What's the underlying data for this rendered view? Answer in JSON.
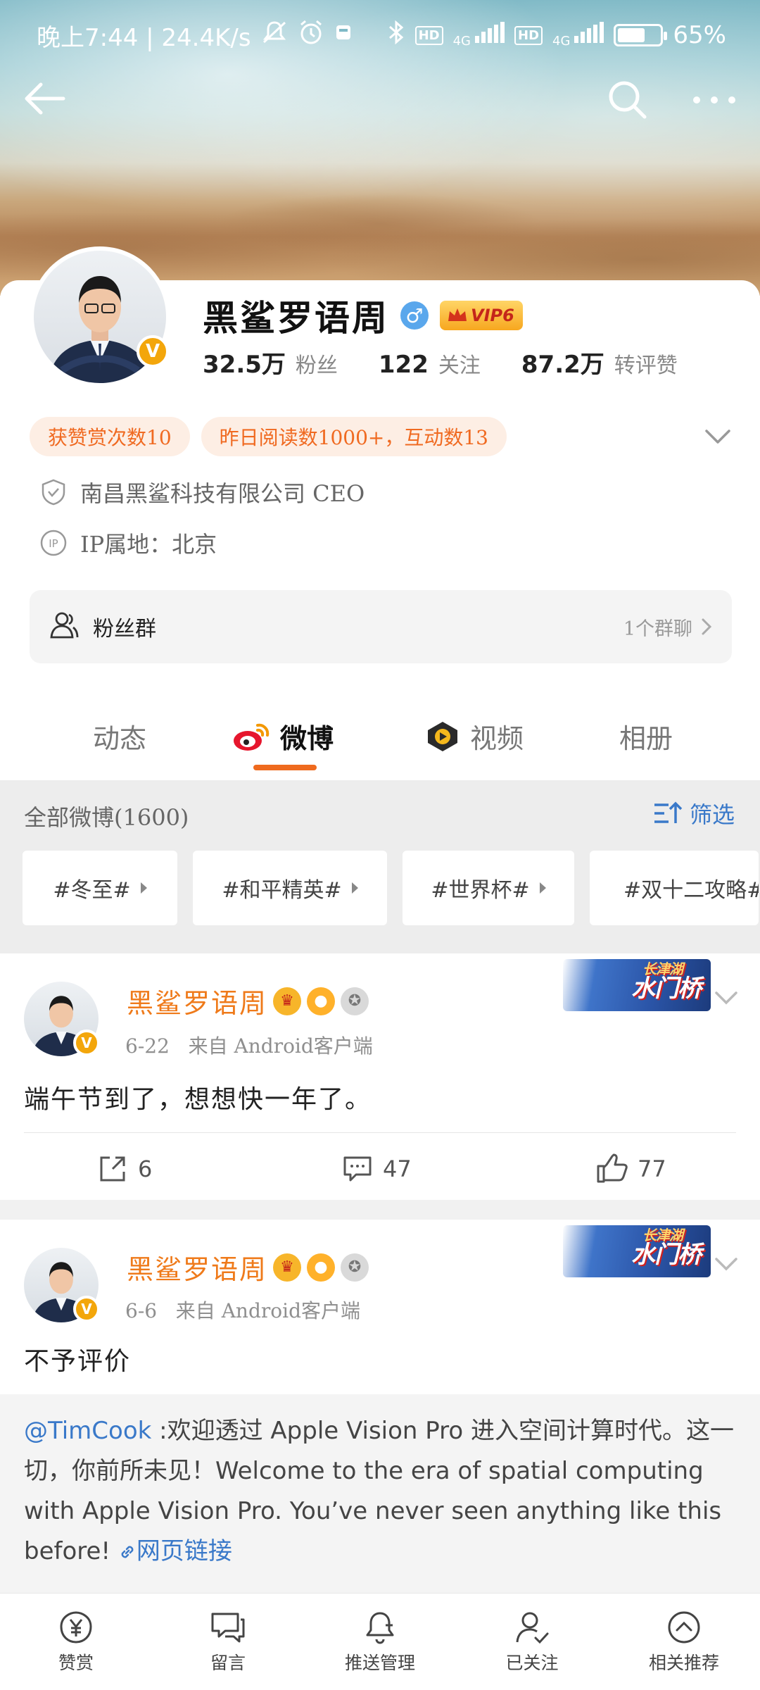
{
  "status_bar": {
    "time_speed": "晚上7:44 | 24.4K/s",
    "battery": "65%",
    "battery_level": 0.65,
    "network_1": "4G",
    "network_2": "4G",
    "hd_1": "HD",
    "hd_2": "HD",
    "icons": [
      "mute-icon",
      "alarm-icon",
      "app-icon",
      "bluetooth-icon",
      "signal-icon",
      "battery-icon"
    ]
  },
  "profile": {
    "name": "黑鲨罗语周",
    "gender_symbol": "♂",
    "vip_label": "VIP6",
    "verified_mark": "V",
    "stats": [
      {
        "value": "32.5万",
        "label": "粉丝"
      },
      {
        "value": "122",
        "label": "关注"
      },
      {
        "value": "87.2万",
        "label": "转评赞"
      }
    ],
    "chips": [
      "获赞赏次数10",
      "昨日阅读数1000+，互动数13"
    ],
    "company": "南昌黑鲨科技有限公司 CEO",
    "ip_location": "IP属地：北京",
    "fan_group": {
      "label": "粉丝群",
      "count": "1个群聊"
    }
  },
  "tabs": [
    {
      "label": "动态",
      "active": false
    },
    {
      "label": "微博",
      "active": true
    },
    {
      "label": "视频",
      "active": false
    },
    {
      "label": "相册",
      "active": false
    }
  ],
  "filter": {
    "title": "全部微博(1600)",
    "button": "筛选",
    "topics": [
      "#冬至#",
      "#和平精英#",
      "#世界杯#",
      "#双十二攻略#"
    ]
  },
  "posts": [
    {
      "author": "黑鲨罗语周",
      "date": "6-22",
      "source": "来自 Android客户端",
      "text": "端午节到了，想想快一年了。",
      "banner_title": "长津湖",
      "banner_text": "水门桥",
      "reposts": "6",
      "comments": "47",
      "likes": "77"
    },
    {
      "author": "黑鲨罗语周",
      "date": "6-6",
      "source": "来自 Android客户端",
      "text": "不予评价",
      "banner_title": "长津湖",
      "banner_text": "水门桥",
      "repost": {
        "mention": "@TimCook",
        "body": " :欢迎透过 Apple Vision Pro 进入空间计算时代。这一切，你前所未见！Welcome to the era of spatial computing with Apple Vision Pro. You’ve never seen anything like this before! ",
        "link": "网页链接"
      }
    }
  ],
  "bottom_bar": [
    "赞赏",
    "留言",
    "推送管理",
    "已关注",
    "相关推荐"
  ],
  "colors": {
    "accent_orange": "#ef6a1e",
    "link_blue": "#3a79c9",
    "verified_gold": "#f3a60b"
  }
}
